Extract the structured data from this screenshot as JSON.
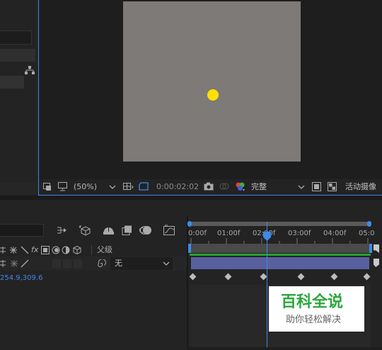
{
  "viewer": {
    "zoom": "(50%)",
    "timecode": "0:00:02:02",
    "quality": "完整",
    "camera": "活动摄像"
  },
  "timeline": {
    "ruler_labels": [
      "0:00f",
      "01:00f",
      "02:00f",
      "03:00f",
      "04:00f",
      "05:0"
    ],
    "column_headers": {
      "fx": "fx",
      "parent": "父级"
    },
    "parent_value": "无",
    "position_value": "254.9,309.6",
    "playhead_time": "0:00:02:02"
  },
  "watermark": {
    "title": "百科全说",
    "subtitle": "助你轻松解决"
  },
  "colors": {
    "panel_bg": "#1a1a1a",
    "canvas": "#7e7a78",
    "dot": "#ffe000",
    "accent": "#3d8be8",
    "layer_bar": "#5860a0",
    "track_green": "#2aa22a",
    "watermark_green": "#2aa83a"
  }
}
